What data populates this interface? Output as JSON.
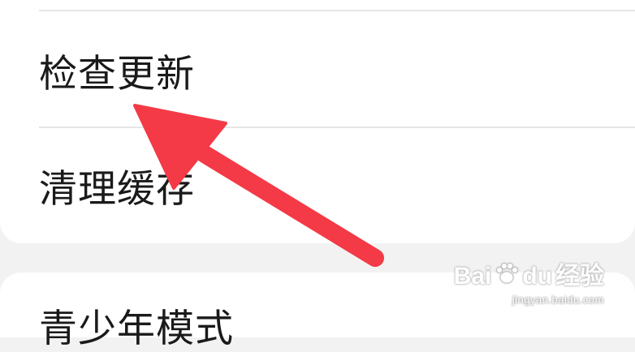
{
  "settings": {
    "rows": [
      {
        "label": "检查更新"
      },
      {
        "label": "清理缓存"
      },
      {
        "label": "青少年模式"
      }
    ]
  },
  "watermark": {
    "brand_left": "Bai",
    "brand_mid": "du",
    "brand_right": "经验",
    "url": "jingyan.baidu.com"
  },
  "colors": {
    "arrow": "#f33a46",
    "background": "#f2f2f2",
    "card": "#ffffff",
    "text": "#1a1a1a",
    "divider": "#e6e6e6"
  }
}
